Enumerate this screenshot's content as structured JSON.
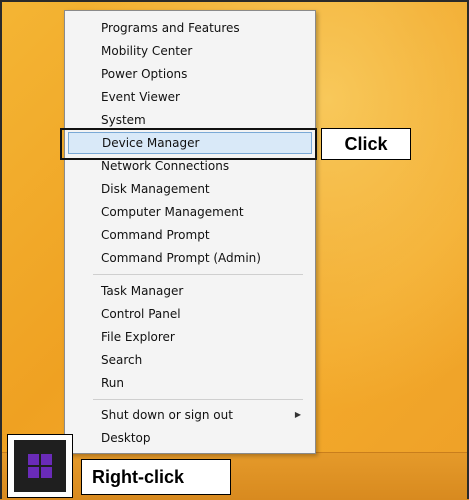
{
  "menu": {
    "items": [
      {
        "label": "Programs and Features"
      },
      {
        "label": "Mobility Center"
      },
      {
        "label": "Power Options"
      },
      {
        "label": "Event Viewer"
      },
      {
        "label": "System"
      },
      {
        "label": "Device Manager",
        "selected": true
      },
      {
        "label": "Network Connections"
      },
      {
        "label": "Disk Management"
      },
      {
        "label": "Computer Management"
      },
      {
        "label": "Command Prompt"
      },
      {
        "label": "Command Prompt (Admin)"
      },
      {
        "label": "Task Manager"
      },
      {
        "label": "Control Panel"
      },
      {
        "label": "File Explorer"
      },
      {
        "label": "Search"
      },
      {
        "label": "Run"
      },
      {
        "label": "Shut down or sign out",
        "has_submenu": true
      },
      {
        "label": "Desktop"
      }
    ]
  },
  "callouts": {
    "click": "Click",
    "right_click": "Right-click"
  },
  "colors": {
    "desktop": "#f2ac2c",
    "menu_bg": "#f4f4f4",
    "selected_bg": "#d9e9f8",
    "start_logo": "#6a2bb8"
  },
  "icons": {
    "start": "windows-logo-icon",
    "submenu": "chevron-right-icon"
  }
}
